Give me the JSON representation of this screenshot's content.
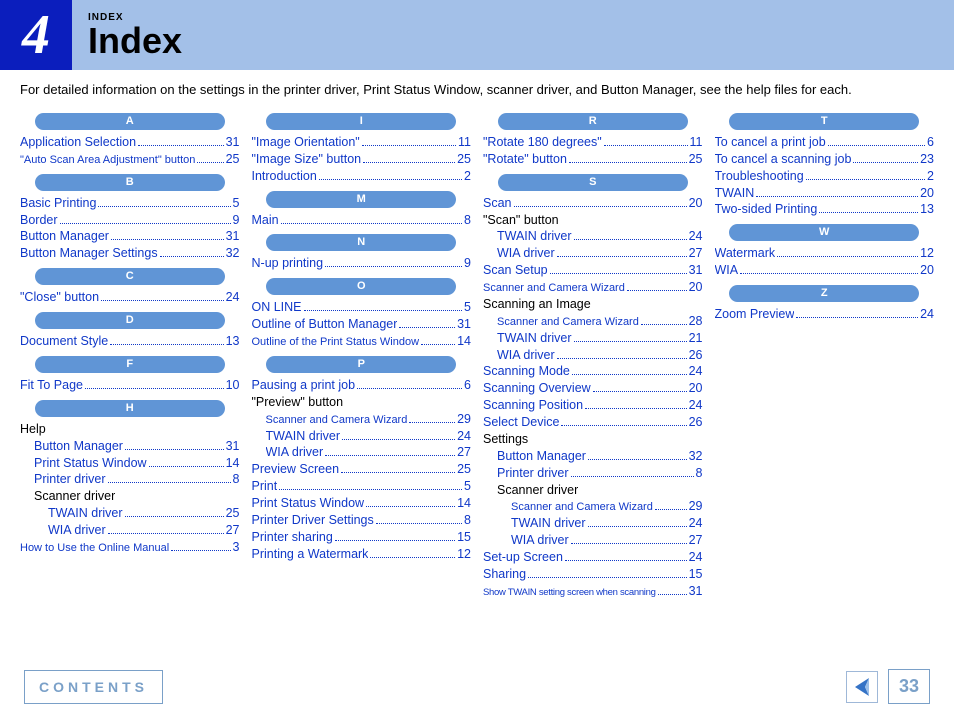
{
  "header": {
    "chapter_number": "4",
    "breadcrumb": "INDEX",
    "title": "Index"
  },
  "intro": "For detailed information on the settings in the printer driver, Print Status Window, scanner driver, and Button Manager, see the help files for each.",
  "columns": [
    [
      {
        "type": "letter",
        "text": "A"
      },
      {
        "type": "entry",
        "label": "Application Selection",
        "page": "31"
      },
      {
        "type": "entry",
        "label": "\"Auto Scan Area Adjustment\" button",
        "page": "25",
        "size": "f11"
      },
      {
        "type": "letter",
        "text": "B"
      },
      {
        "type": "entry",
        "label": "Basic Printing",
        "page": "5"
      },
      {
        "type": "entry",
        "label": "Border",
        "page": "9"
      },
      {
        "type": "entry",
        "label": "Button Manager",
        "page": "31"
      },
      {
        "type": "entry",
        "label": "Button Manager Settings",
        "page": "32"
      },
      {
        "type": "letter",
        "text": "C"
      },
      {
        "type": "entry",
        "label": "\"Close\" button",
        "page": "24"
      },
      {
        "type": "letter",
        "text": "D"
      },
      {
        "type": "entry",
        "label": "Document Style",
        "page": "13"
      },
      {
        "type": "letter",
        "text": "F"
      },
      {
        "type": "entry",
        "label": "Fit To Page",
        "page": "10"
      },
      {
        "type": "letter",
        "text": "H"
      },
      {
        "type": "entry",
        "label": "Help",
        "plain": true,
        "noleader": true
      },
      {
        "type": "entry",
        "label": "Button Manager",
        "page": "31",
        "indent": 1
      },
      {
        "type": "entry",
        "label": "Print Status Window",
        "page": "14",
        "indent": 1
      },
      {
        "type": "entry",
        "label": "Printer driver",
        "page": "8",
        "indent": 1
      },
      {
        "type": "entry",
        "label": "Scanner driver",
        "plain": true,
        "noleader": true,
        "indent": 1
      },
      {
        "type": "entry",
        "label": "TWAIN driver",
        "page": "25",
        "indent": 2
      },
      {
        "type": "entry",
        "label": "WIA driver",
        "page": "27",
        "indent": 2
      },
      {
        "type": "entry",
        "label": "How to Use the Online Manual",
        "page": "3",
        "size": "f11"
      }
    ],
    [
      {
        "type": "letter",
        "text": "I"
      },
      {
        "type": "entry",
        "label": "\"Image Orientation\"",
        "page": "11"
      },
      {
        "type": "entry",
        "label": "\"Image Size\" button",
        "page": "25"
      },
      {
        "type": "entry",
        "label": "Introduction",
        "page": "2"
      },
      {
        "type": "letter",
        "text": "M"
      },
      {
        "type": "entry",
        "label": "Main",
        "page": "8"
      },
      {
        "type": "letter",
        "text": "N"
      },
      {
        "type": "entry",
        "label": "N-up printing",
        "page": "9"
      },
      {
        "type": "letter",
        "text": "O"
      },
      {
        "type": "entry",
        "label": "ON LINE",
        "page": "5"
      },
      {
        "type": "entry",
        "label": "Outline of Button Manager",
        "page": "31"
      },
      {
        "type": "entry",
        "label": "Outline of the Print Status Window",
        "page": "14",
        "size": "f11"
      },
      {
        "type": "letter",
        "text": "P"
      },
      {
        "type": "entry",
        "label": "Pausing a print job",
        "page": "6"
      },
      {
        "type": "entry",
        "label": "\"Preview\" button",
        "plain": true,
        "noleader": true
      },
      {
        "type": "entry",
        "label": "Scanner and Camera Wizard",
        "page": "29",
        "indent": 1,
        "size": "f11"
      },
      {
        "type": "entry",
        "label": "TWAIN driver",
        "page": "24",
        "indent": 1
      },
      {
        "type": "entry",
        "label": "WIA driver",
        "page": "27",
        "indent": 1
      },
      {
        "type": "entry",
        "label": "Preview Screen",
        "page": "25"
      },
      {
        "type": "entry",
        "label": "Print",
        "page": "5"
      },
      {
        "type": "entry",
        "label": "Print Status Window",
        "page": "14"
      },
      {
        "type": "entry",
        "label": "Printer Driver Settings",
        "page": "8"
      },
      {
        "type": "entry",
        "label": "Printer sharing",
        "page": "15"
      },
      {
        "type": "entry",
        "label": "Printing a Watermark",
        "page": "12"
      }
    ],
    [
      {
        "type": "letter",
        "text": "R"
      },
      {
        "type": "entry",
        "label": "\"Rotate 180 degrees\"",
        "page": "11"
      },
      {
        "type": "entry",
        "label": "\"Rotate\" button",
        "page": "25"
      },
      {
        "type": "letter",
        "text": "S"
      },
      {
        "type": "entry",
        "label": "Scan",
        "page": "20"
      },
      {
        "type": "entry",
        "label": "\"Scan\" button",
        "plain": true,
        "noleader": true
      },
      {
        "type": "entry",
        "label": "TWAIN driver",
        "page": "24",
        "indent": 1
      },
      {
        "type": "entry",
        "label": "WIA driver",
        "page": "27",
        "indent": 1
      },
      {
        "type": "entry",
        "label": "Scan Setup",
        "page": "31"
      },
      {
        "type": "entry",
        "label": "Scanner and Camera Wizard",
        "page": "20",
        "size": "f11"
      },
      {
        "type": "entry",
        "label": "Scanning an Image",
        "plain": true,
        "noleader": true
      },
      {
        "type": "entry",
        "label": "Scanner and Camera Wizard",
        "page": "28",
        "indent": 1,
        "size": "f11"
      },
      {
        "type": "entry",
        "label": "TWAIN driver",
        "page": "21",
        "indent": 1
      },
      {
        "type": "entry",
        "label": "WIA driver",
        "page": "26",
        "indent": 1
      },
      {
        "type": "entry",
        "label": "Scanning Mode",
        "page": "24"
      },
      {
        "type": "entry",
        "label": "Scanning Overview",
        "page": "20"
      },
      {
        "type": "entry",
        "label": "Scanning Position",
        "page": "24"
      },
      {
        "type": "entry",
        "label": "Select Device",
        "page": "26"
      },
      {
        "type": "entry",
        "label": "Settings",
        "plain": true,
        "noleader": true
      },
      {
        "type": "entry",
        "label": "Button Manager",
        "page": "32",
        "indent": 1
      },
      {
        "type": "entry",
        "label": "Printer driver",
        "page": "8",
        "indent": 1
      },
      {
        "type": "entry",
        "label": "Scanner driver",
        "plain": true,
        "noleader": true,
        "indent": 1
      },
      {
        "type": "entry",
        "label": "Scanner and Camera Wizard",
        "page": "29",
        "indent": 2,
        "size": "f11"
      },
      {
        "type": "entry",
        "label": "TWAIN driver",
        "page": "24",
        "indent": 2
      },
      {
        "type": "entry",
        "label": "WIA driver",
        "page": "27",
        "indent": 2
      },
      {
        "type": "entry",
        "label": "Set-up Screen",
        "page": "24"
      },
      {
        "type": "entry",
        "label": "Sharing",
        "page": "15"
      },
      {
        "type": "entry",
        "label": "Show TWAIN setting screen when scanning",
        "page": "31",
        "size": "f10"
      }
    ],
    [
      {
        "type": "letter",
        "text": "T"
      },
      {
        "type": "entry",
        "label": "To cancel a print job",
        "page": "6"
      },
      {
        "type": "entry",
        "label": "To cancel a scanning job",
        "page": "23"
      },
      {
        "type": "entry",
        "label": "Troubleshooting",
        "page": "2"
      },
      {
        "type": "entry",
        "label": "TWAIN",
        "page": "20"
      },
      {
        "type": "entry",
        "label": "Two-sided Printing",
        "page": "13"
      },
      {
        "type": "letter",
        "text": "W"
      },
      {
        "type": "entry",
        "label": "Watermark",
        "page": "12"
      },
      {
        "type": "entry",
        "label": "WIA",
        "page": "20"
      },
      {
        "type": "letter",
        "text": "Z"
      },
      {
        "type": "entry",
        "label": "Zoom Preview",
        "page": "24"
      }
    ]
  ],
  "footer": {
    "contents": "CONTENTS",
    "page": "33"
  }
}
